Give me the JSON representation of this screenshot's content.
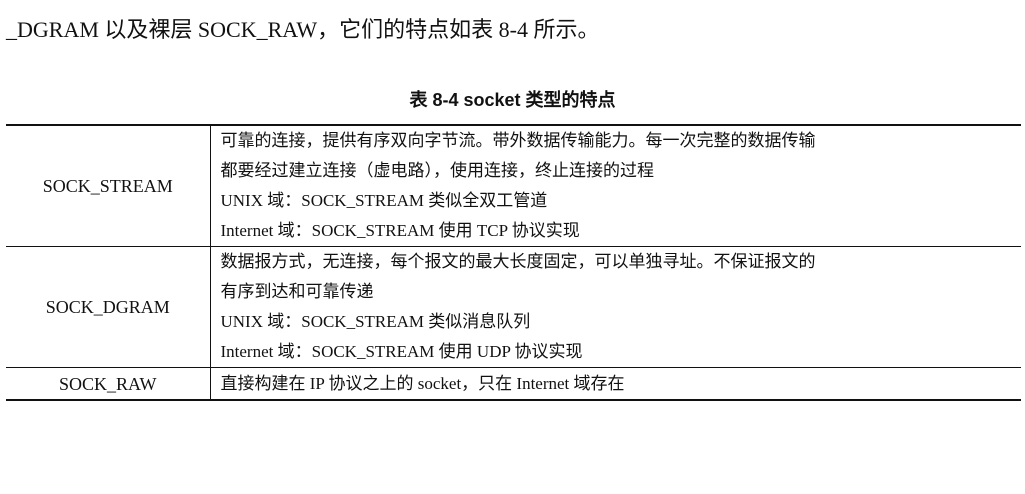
{
  "intro_text": "_DGRAM 以及裸层 SOCK_RAW，它们的特点如表 8-4 所示。",
  "caption": "表 8-4    socket 类型的特点",
  "rows": [
    {
      "name": "SOCK_STREAM",
      "lines": [
        "可靠的连接，提供有序双向字节流。带外数据传输能力。每一次完整的数据传输",
        "都要经过建立连接（虚电路），使用连接，终止连接的过程",
        "UNIX 域：SOCK_STREAM 类似全双工管道",
        "Internet 域：SOCK_STREAM 使用 TCP 协议实现"
      ]
    },
    {
      "name": "SOCK_DGRAM",
      "lines": [
        "数据报方式，无连接，每个报文的最大长度固定，可以单独寻址。不保证报文的",
        "有序到达和可靠传递",
        "UNIX 域：SOCK_STREAM 类似消息队列",
        "Internet 域：SOCK_STREAM 使用 UDP 协议实现"
      ]
    },
    {
      "name": "SOCK_RAW",
      "lines": [
        "直接构建在 IP 协议之上的 socket，只在 Internet 域存在"
      ]
    }
  ]
}
